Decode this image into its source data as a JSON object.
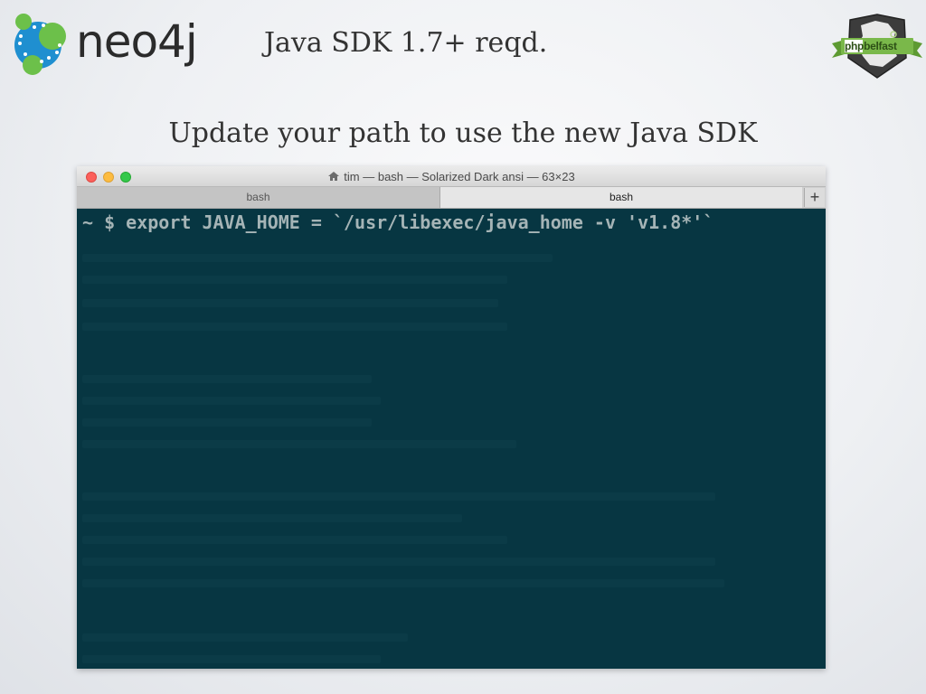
{
  "slide": {
    "logo_text": "neo4j",
    "subtitle": "Java SDK 1.7+ reqd.",
    "heading": "Update your path to use the new Java SDK",
    "badge_text": "phpbelfast"
  },
  "terminal": {
    "window_title": "tim — bash — Solarized Dark ansi — 63×23",
    "tabs": [
      {
        "label": "bash",
        "active": false
      },
      {
        "label": "bash",
        "active": true
      }
    ],
    "new_tab_label": "+",
    "command_line": "~ $ export JAVA_HOME = `/usr/libexec/java_home -v 'v1.8*'`"
  },
  "colors": {
    "terminal_bg": "#073642",
    "terminal_fg": "#a5b4b6",
    "close": "#fc605b",
    "minimize": "#fdbc40",
    "maximize": "#34c84a",
    "logo_blue": "#1f8fd0",
    "logo_green": "#6cc04a",
    "badge_green": "#7ab84a"
  },
  "icons": {
    "logo": "neo4j-graph-logo",
    "home": "home-icon",
    "badge": "ireland-map-badge"
  }
}
